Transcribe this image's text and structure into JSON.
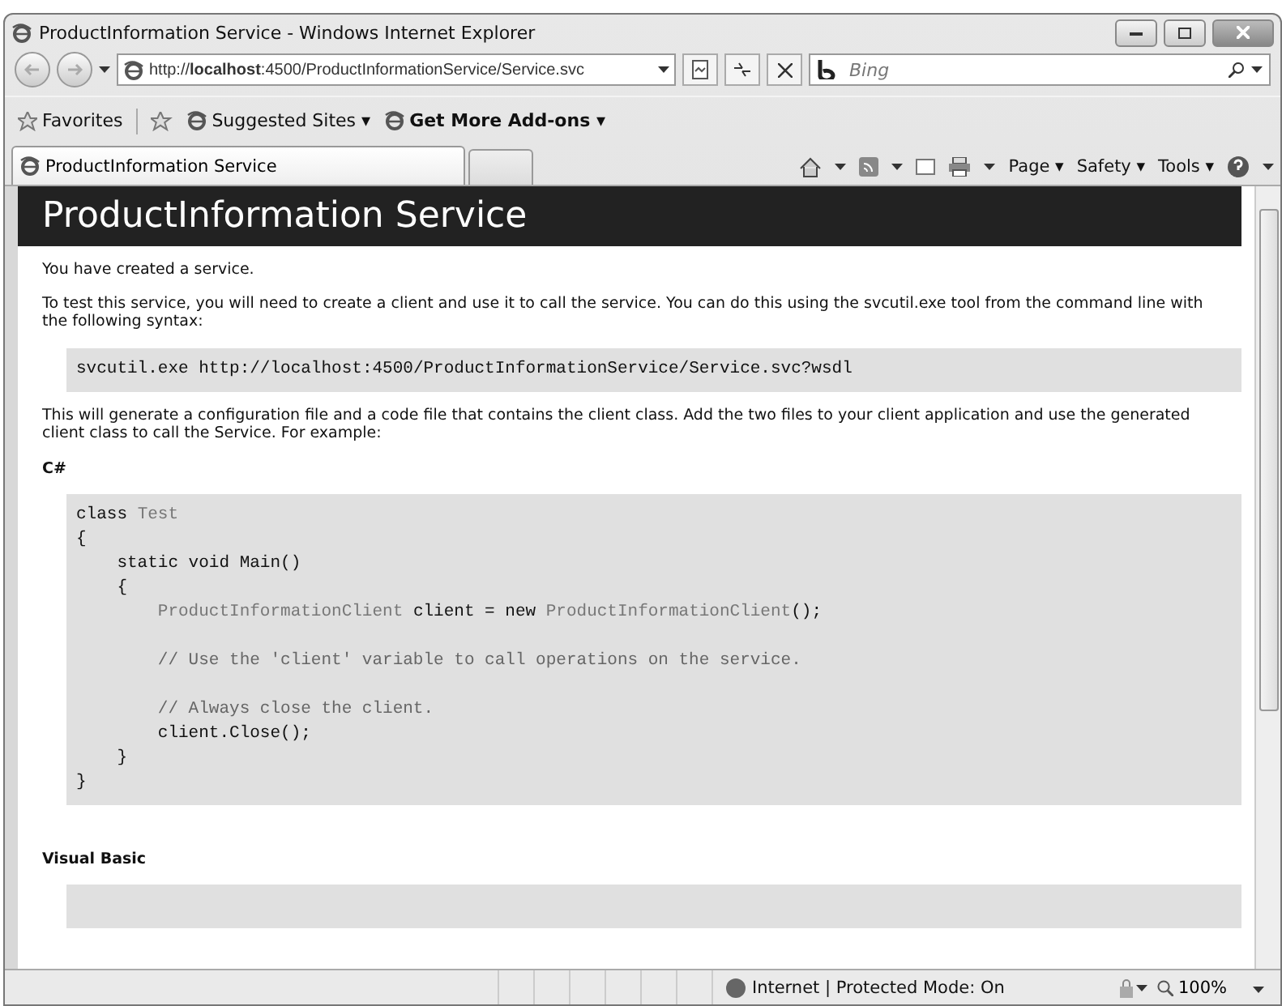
{
  "window": {
    "title": "ProductInformation Service - Windows Internet Explorer"
  },
  "address_bar": {
    "url": "http://**localhost**:4500/ProductInformationService/Service.svc"
  },
  "search": {
    "placeholder": "Bing"
  },
  "favorites_bar": {
    "favorites": "Favorites",
    "items": [
      {
        "label": "Suggested Sites ▾",
        "bold": false
      },
      {
        "label": "Get More Add-ons ▾",
        "bold": true
      }
    ]
  },
  "tabs": [
    {
      "label": "ProductInformation Service",
      "selected": true
    },
    {
      "selected": false
    }
  ],
  "command_bar": [
    "Page ▾",
    "Safety ▾",
    "Tools ▾"
  ],
  "page": {
    "heading": "ProductInformation Service",
    "intro": "You have created a service.",
    "instructions": "To test this service, you will need to create a client and use it to call the service. You can do this using the svcutil.exe tool from the command line with the following syntax:",
    "command": {
      "program": "svcutil.exe",
      "link": "http://localhost:4500/ProductInformationService/Service.svc?wsdl"
    },
    "explanation": "This will generate a configuration file and a code file that contains the client class. Add the two files to your client application and use the generated client class to call the Service. For example:",
    "sections": [
      {
        "label": "C#",
        "line_groups": [
          [
            [
              {
                "text": "class ",
                "kind": "keyword"
              },
              {
                "text": "Test",
                "kind": "type"
              }
            ],
            [
              {
                "text": "{",
                "kind": "plain"
              }
            ],
            [
              {
                "text": "    static void Main()",
                "kind": "keyword"
              }
            ],
            [
              {
                "text": "    {",
                "kind": "plain"
              }
            ],
            [
              {
                "text": "        ProductInformationClient",
                "kind": "type"
              },
              {
                "text": " client = new ",
                "kind": "keyword"
              },
              {
                "text": "ProductInformationClient",
                "kind": "type"
              },
              {
                "text": "();",
                "kind": "plain"
              }
            ]
          ],
          [
            [
              {
                "text": "        // Use the 'client' variable to call operations on the service.",
                "kind": "comment"
              }
            ]
          ],
          [
            [
              {
                "text": "        // Always close the client.",
                "kind": "comment"
              }
            ],
            [
              {
                "text": "        client.Close();",
                "kind": "keyword"
              }
            ],
            [
              {
                "text": "    }",
                "kind": "plain"
              }
            ],
            [
              {
                "text": "}",
                "kind": "plain"
              }
            ]
          ]
        ]
      },
      {
        "label": "Visual Basic"
      }
    ]
  },
  "status_bar": {
    "zone": "Internet | Protected Mode: On",
    "zoom": "100%"
  }
}
